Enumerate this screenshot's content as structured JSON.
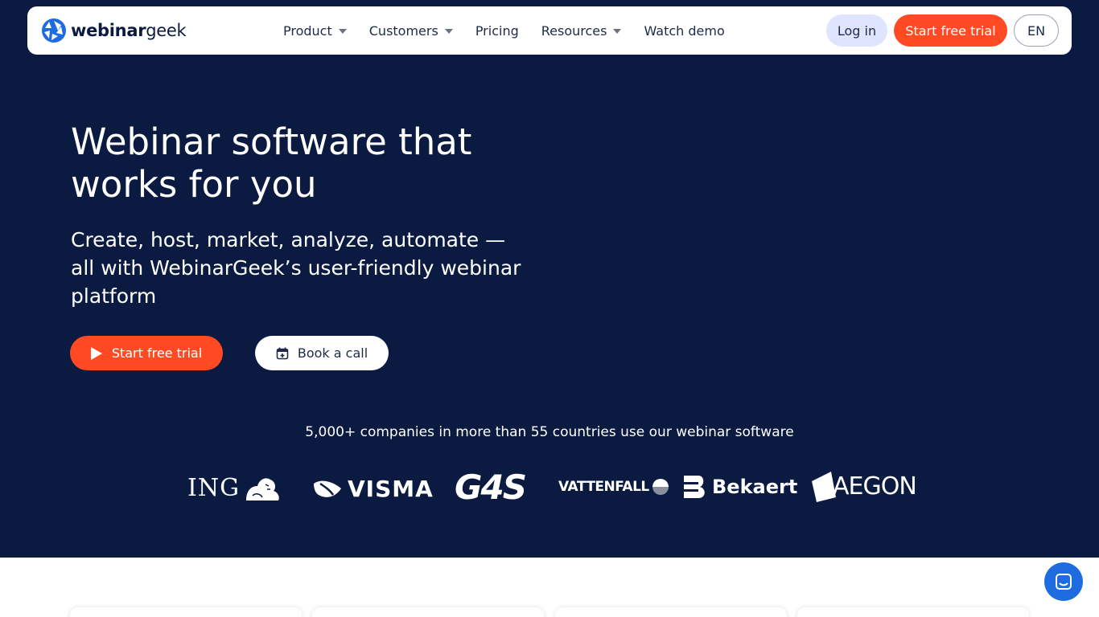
{
  "nav": {
    "logo_bold": "webinar",
    "logo_light": "geek",
    "menu": [
      {
        "label": "Product",
        "has_dropdown": true
      },
      {
        "label": "Customers",
        "has_dropdown": true
      },
      {
        "label": "Pricing",
        "has_dropdown": false
      },
      {
        "label": "Resources",
        "has_dropdown": true
      },
      {
        "label": "Watch demo",
        "has_dropdown": false
      }
    ],
    "login_label": "Log in",
    "trial_label": "Start free trial",
    "lang_label": "EN"
  },
  "hero": {
    "title": "Webinar software that works for you",
    "subtitle": "Create, host, market, analyze, automate — all with WebinarGeek’s user-friendly webinar platform",
    "cta_trial_label": "Start free trial",
    "cta_call_label": "Book a call",
    "companies_text": "5,000+ companies in more than 55 countries use our webinar software"
  },
  "logos": {
    "ing": "ING",
    "visma": "VISMA",
    "g4s": "G4S",
    "vattenfall": "VATTENFALL",
    "bekaert": "Bekaert",
    "aegon": "AEGON"
  },
  "colors": {
    "hero_bg": "#0b1a40",
    "accent": "#ff4a23",
    "login_bg": "#dfe4ff",
    "chat": "#1f6be0"
  },
  "icons": [
    "webinargeek-logo-icon",
    "chevron-down-icon",
    "play-icon",
    "calendar-plus-icon",
    "chat-icon"
  ]
}
